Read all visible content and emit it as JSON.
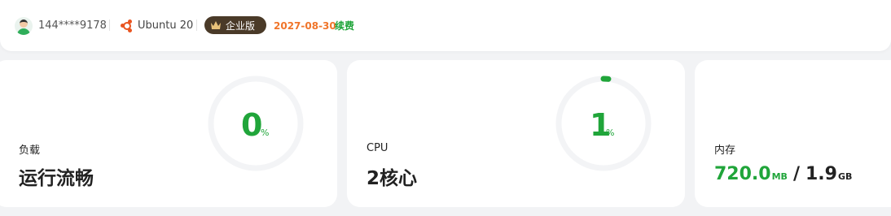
{
  "topbar": {
    "phone": "144****9178",
    "os": "Ubuntu 20",
    "edition": "企业版",
    "expire_date": "2027-08-30",
    "renew": "续费"
  },
  "cards": {
    "load": {
      "gauge_value": "0",
      "gauge_unit": "%",
      "gauge_percent": 0,
      "label": "负载",
      "value": "运行流畅"
    },
    "cpu": {
      "gauge_value": "1",
      "gauge_unit": "%",
      "gauge_percent": 1,
      "label": "CPU",
      "value": "2核心"
    },
    "memory": {
      "label": "内存",
      "used": "720.0",
      "used_unit": "MB",
      "slash": "/",
      "total": "1.9",
      "total_unit": "GB"
    }
  },
  "colors": {
    "accent_green": "#20a53a",
    "expire_orange": "#f0752a",
    "badge_bg": "#4a3a28",
    "ubuntu_orange": "#e95420"
  },
  "icons": [
    "avatar",
    "ubuntu-icon",
    "crown-icon"
  ]
}
